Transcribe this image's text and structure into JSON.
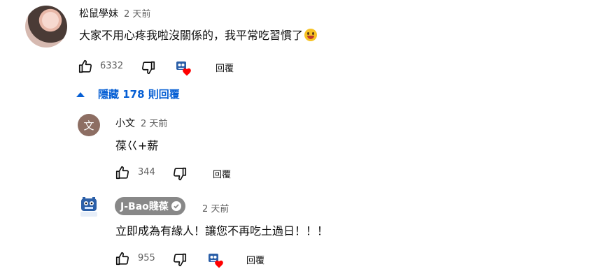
{
  "comment": {
    "author": "松鼠學妹",
    "time": "2 天前",
    "text": "大家不用心疼我啦沒關係的，我平常吃習慣了",
    "like_count": "6332",
    "reply_label": "回覆",
    "emoji_icon": "grinning-face-emoji"
  },
  "replies_toggle": {
    "label": "隱藏 178 則回覆"
  },
  "replies": [
    {
      "author": "小文",
      "avatar_letter": "文",
      "time": "2 天前",
      "text": "葆巜+薪",
      "like_count": "344",
      "reply_label": "回覆"
    },
    {
      "author": "J-Bao賤葆",
      "time": "2 天前",
      "text": "立即成為有緣人！讓您不再吃土過日！！！",
      "like_count": "955",
      "reply_label": "回覆"
    }
  ],
  "colors": {
    "link_blue": "#065fd4",
    "heart_red": "#ff0000",
    "chip_gray": "#888888",
    "secondary_text": "#606060"
  }
}
